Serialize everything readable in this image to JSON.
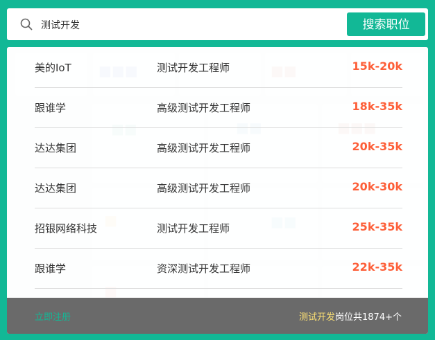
{
  "search": {
    "value": "测试开发",
    "button_label": "搜索职位"
  },
  "jobs": [
    {
      "company": "美的IoT",
      "position": "测试开发工程师",
      "salary": "15k-20k"
    },
    {
      "company": "跟谁学",
      "position": "高级测试开发工程师",
      "salary": "18k-35k"
    },
    {
      "company": "达达集团",
      "position": "高级测试开发工程师",
      "salary": "20k-35k"
    },
    {
      "company": "达达集团",
      "position": "高级测试开发工程师",
      "salary": "20k-30k"
    },
    {
      "company": "招银网络科技",
      "position": "测试开发工程师",
      "salary": "25k-35k"
    },
    {
      "company": "跟谁学",
      "position": "资深测试开发工程师",
      "salary": "22k-35k"
    }
  ],
  "footer": {
    "register_label": "立即注册",
    "keyword": "测试开发",
    "count_text": "岗位共1874+个"
  },
  "colors": {
    "accent": "#12b896",
    "salary": "#fd5f39",
    "keyword": "#fde174"
  }
}
